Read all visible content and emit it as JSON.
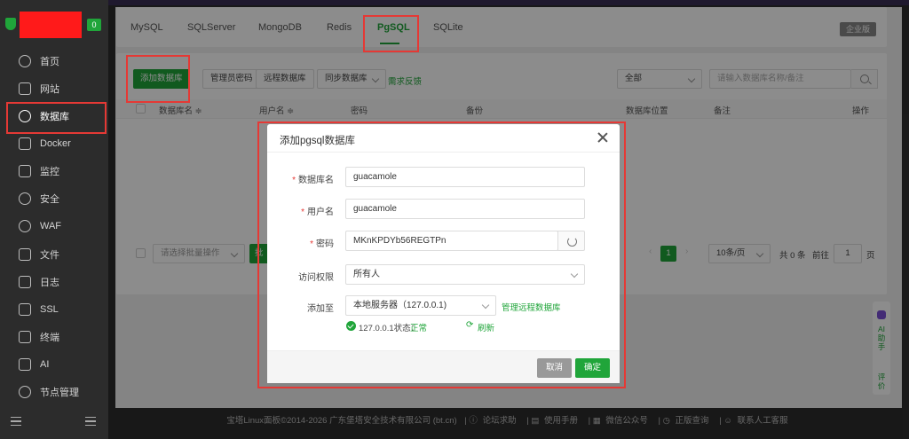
{
  "sidebar": {
    "badge": "0",
    "items": [
      {
        "label": "首页",
        "icon": "home-icon"
      },
      {
        "label": "网站",
        "icon": "globe-icon"
      },
      {
        "label": "数据库",
        "icon": "database-icon"
      },
      {
        "label": "Docker",
        "icon": "docker-icon"
      },
      {
        "label": "监控",
        "icon": "monitor-icon"
      },
      {
        "label": "安全",
        "icon": "shield-icon"
      },
      {
        "label": "WAF",
        "icon": "waf-icon"
      },
      {
        "label": "文件",
        "icon": "folder-icon"
      },
      {
        "label": "日志",
        "icon": "log-icon"
      },
      {
        "label": "SSL",
        "icon": "ssl-icon"
      },
      {
        "label": "终端",
        "icon": "terminal-icon"
      },
      {
        "label": "AI",
        "icon": "ai-icon"
      },
      {
        "label": "节点管理",
        "icon": "node-icon"
      }
    ]
  },
  "tabs": [
    "MySQL",
    "SQLServer",
    "MongoDB",
    "Redis",
    "PgSQL",
    "SQLite"
  ],
  "active_tab": "PgSQL",
  "enterprise_label": "企业版",
  "toolbar": {
    "add_db": "添加数据库",
    "admin_pwd": "管理员密码",
    "remote_db": "远程数据库",
    "sync_db": "同步数据库",
    "feedback": "需求反馈",
    "filter_value": "全部",
    "search_placeholder": "请输入数据库名称/备注"
  },
  "table_headers": {
    "name": "数据库名 ≑",
    "user": "用户名 ≑",
    "password": "密码",
    "backup": "备份",
    "location": "数据库位置",
    "note": "备注",
    "action": "操作"
  },
  "table_footer": {
    "batch_placeholder": "请选择批量操作",
    "batch_btn": "批",
    "page": "1",
    "per_page": "10条/页",
    "total": "共 0 条",
    "goto_label": "前往",
    "goto_value": "1",
    "page_suffix": "页"
  },
  "footer": {
    "copyright": "宝塔Linux面板©2014-2026 广东堡塔安全技术有限公司 (bt.cn)",
    "links": [
      "论坛求助",
      "使用手册",
      "微信公众号",
      "正版查询",
      "联系人工客服"
    ]
  },
  "side_float": {
    "ai": "AI助手",
    "rate": "评价"
  },
  "modal": {
    "title": "添加pgsql数据库",
    "labels": {
      "db_name": "数据库名",
      "username": "用户名",
      "password": "密码",
      "access": "访问权限",
      "add_to": "添加至"
    },
    "required_mark": "*",
    "values": {
      "db_name": "guacamole",
      "username": "guacamole",
      "password": "MKnKPDYb56REGTPn",
      "access": "所有人",
      "add_to": "本地服务器（127.0.0.1)"
    },
    "manage_remote": "管理远程数据库",
    "status_prefix": "127.0.0.1状态：",
    "status_value": "正常",
    "refresh": "刷新",
    "cancel": "取消",
    "confirm": "确定"
  },
  "colors": {
    "accent": "#20a53a",
    "highlight": "#e53935",
    "sidebar_bg": "#2c2c2c"
  }
}
